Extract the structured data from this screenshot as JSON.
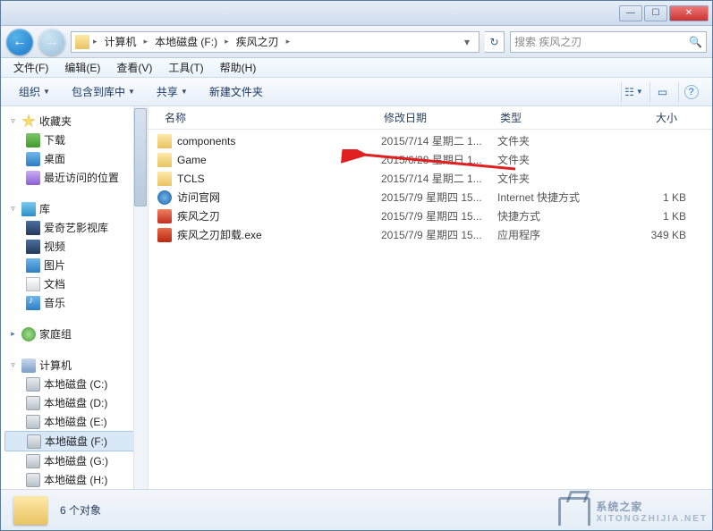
{
  "titlebar": {
    "min": "—",
    "max": "☐",
    "close": "✕"
  },
  "nav": {
    "back": "←",
    "forward": "→",
    "refresh": "↻"
  },
  "breadcrumb": {
    "items": [
      "计算机",
      "本地磁盘 (F:)",
      "疾风之刃"
    ]
  },
  "search": {
    "placeholder": "搜索 疾风之刃",
    "icon": "🔍"
  },
  "menubar": [
    "文件(F)",
    "编辑(E)",
    "查看(V)",
    "工具(T)",
    "帮助(H)"
  ],
  "toolbar": {
    "organize": "组织",
    "include": "包含到库中",
    "share": "共享",
    "newfolder": "新建文件夹",
    "view_icon": "☷",
    "preview_icon": "▭",
    "help_icon": "?"
  },
  "sidebar": {
    "favorites": {
      "label": "收藏夹",
      "items": [
        "下载",
        "桌面",
        "最近访问的位置"
      ]
    },
    "libraries": {
      "label": "库",
      "items": [
        "爱奇艺影视库",
        "视频",
        "图片",
        "文档",
        "音乐"
      ]
    },
    "homegroup": {
      "label": "家庭组"
    },
    "computer": {
      "label": "计算机",
      "items": [
        "本地磁盘 (C:)",
        "本地磁盘 (D:)",
        "本地磁盘 (E:)",
        "本地磁盘 (F:)",
        "本地磁盘 (G:)",
        "本地磁盘 (H:)"
      ]
    }
  },
  "columns": {
    "name": "名称",
    "date": "修改日期",
    "type": "类型",
    "size": "大小"
  },
  "files": [
    {
      "icon": "folder",
      "name": "components",
      "date": "2015/7/14 星期二 1...",
      "type": "文件夹",
      "size": ""
    },
    {
      "icon": "folder",
      "name": "Game",
      "date": "2015/6/28 星期日 1...",
      "type": "文件夹",
      "size": ""
    },
    {
      "icon": "folder",
      "name": "TCLS",
      "date": "2015/7/14 星期二 1...",
      "type": "文件夹",
      "size": ""
    },
    {
      "icon": "ie",
      "name": "访问官网",
      "date": "2015/7/9 星期四 15...",
      "type": "Internet 快捷方式",
      "size": "1 KB"
    },
    {
      "icon": "exe",
      "name": "疾风之刃",
      "date": "2015/7/9 星期四 15...",
      "type": "快捷方式",
      "size": "1 KB"
    },
    {
      "icon": "exe2",
      "name": "疾风之刃卸载.exe",
      "date": "2015/7/9 星期四 15...",
      "type": "应用程序",
      "size": "349 KB"
    }
  ],
  "statusbar": {
    "count": "6 个对象"
  },
  "watermark": {
    "text": "系统之家",
    "sub": "XITONGZHIJIA.NET"
  }
}
